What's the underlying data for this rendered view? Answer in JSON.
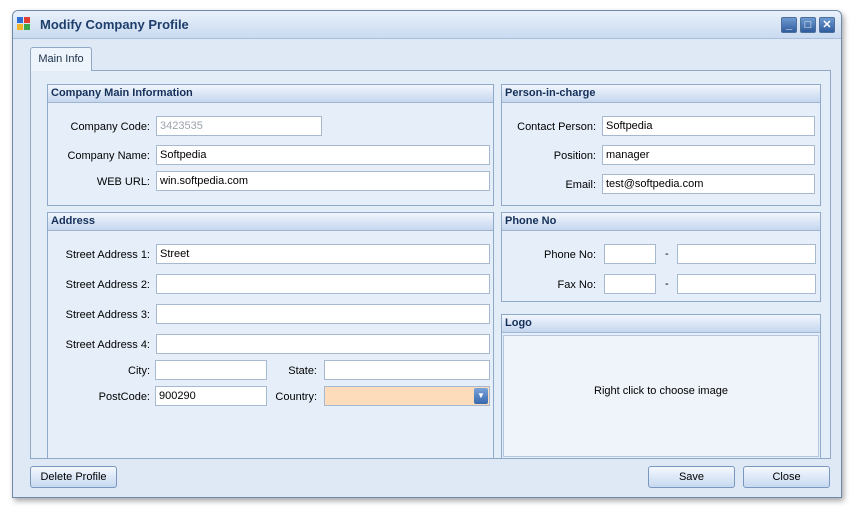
{
  "window": {
    "title": "Modify Company Profile"
  },
  "tab": {
    "label": "Main Info"
  },
  "company": {
    "header": "Company Main Information",
    "code_label": "Company Code:",
    "code_value": "3423535",
    "name_label": "Company Name:",
    "name_value": "Softpedia",
    "url_label": "WEB URL:",
    "url_value": "win.softpedia.com"
  },
  "person": {
    "header": "Person-in-charge",
    "contact_label": "Contact Person:",
    "contact_value": "Softpedia",
    "position_label": "Position:",
    "position_value": "manager",
    "email_label": "Email:",
    "email_value": "test@softpedia.com"
  },
  "address": {
    "header": "Address",
    "street1_label": "Street Address 1:",
    "street1_value": "Street",
    "street2_label": "Street Address 2:",
    "street2_value": "",
    "street3_label": "Street Address 3:",
    "street3_value": "",
    "street4_label": "Street Address 4:",
    "street4_value": "",
    "city_label": "City:",
    "city_value": "",
    "state_label": "State:",
    "state_value": "",
    "postcode_label": "PostCode:",
    "postcode_value": "900290",
    "country_label": "Country:",
    "country_value": ""
  },
  "phone": {
    "header": "Phone No",
    "phone_label": "Phone No:",
    "fax_label": "Fax No:",
    "separator": "-"
  },
  "logo": {
    "header": "Logo",
    "hint": "Right click to choose image"
  },
  "buttons": {
    "delete": "Delete Profile",
    "save": "Save",
    "close": "Close"
  },
  "colors": {
    "country_field": "#fcdcbb",
    "title_text": "#1e3e6b"
  },
  "icons": [
    "app-icon",
    "minimize-icon",
    "maximize-icon",
    "close-icon",
    "dropdown-arrow-icon"
  ]
}
